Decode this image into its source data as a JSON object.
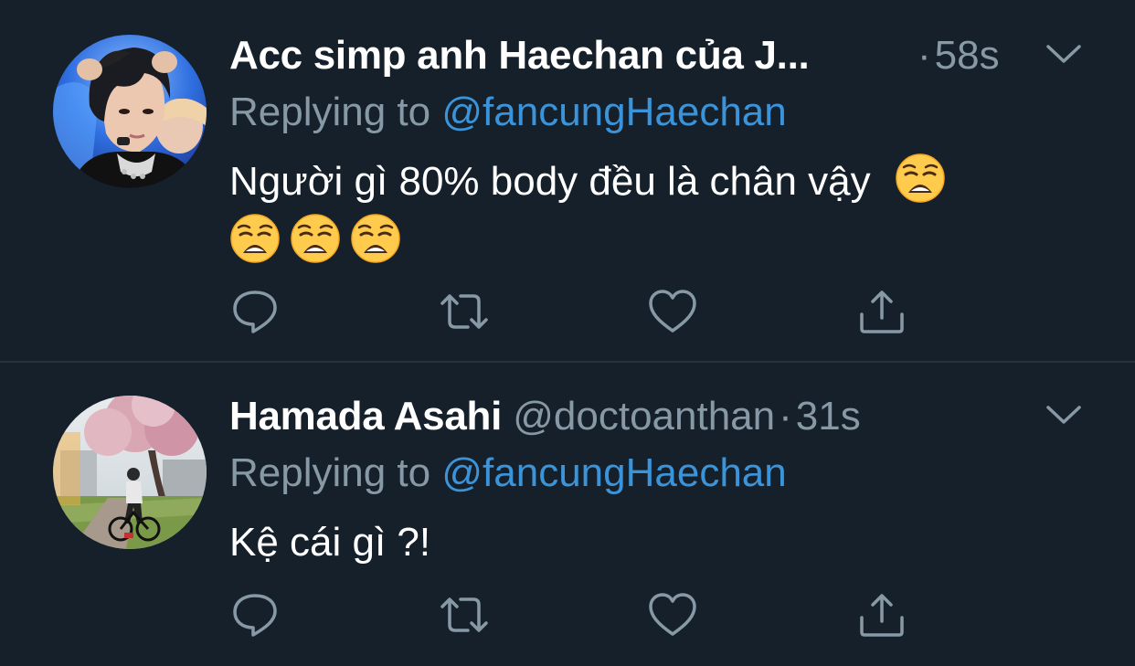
{
  "tweets": [
    {
      "display_name": "Acc simp anh Haechan của J...",
      "handle": "",
      "separator": "·",
      "timestamp": "58s",
      "reply_prefix": "Replying to",
      "reply_to": "@fancungHaechan",
      "text_line1": "Người gì 80% body đều là chân vậy",
      "emoji_name": "weary-face",
      "emoji_count": 4,
      "avatar": "person-portrait"
    },
    {
      "display_name": "Hamada Asahi",
      "handle": "@doctoanthan",
      "separator": "·",
      "timestamp": "31s",
      "reply_prefix": "Replying to",
      "reply_to": "@fancungHaechan",
      "text": "Kệ cái gì ?!",
      "avatar": "cherry-blossom-bicycle-photo"
    }
  ],
  "actions": {
    "reply": "reply-icon",
    "retweet": "retweet-icon",
    "like": "heart-icon",
    "share": "share-icon"
  },
  "colors": {
    "background": "#15202b",
    "text_primary": "#ffffff",
    "text_secondary": "#8899a6",
    "link": "#3b94d9",
    "divider": "#26323f"
  }
}
